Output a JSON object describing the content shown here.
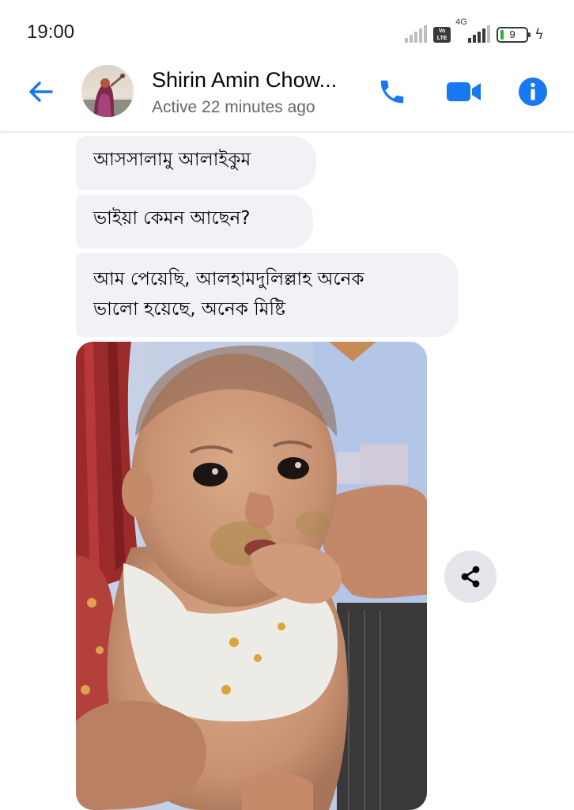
{
  "status_bar": {
    "time": "19:00",
    "volte_label": "Vo\nLTE",
    "network_label": "4G",
    "battery_level": "9"
  },
  "header": {
    "back_icon": "arrow-left-icon",
    "contact_name": "Shirin Amin Chow...",
    "contact_status": "Active 22 minutes ago",
    "accent_color": "#1877f2"
  },
  "messages": [
    {
      "text": "আসসালামু আলাইকুম"
    },
    {
      "text": "ভাইয়া কেমন আছেন?"
    },
    {
      "line1": "আম পেয়েছি, আলহামদুলিল্লাহ অনেক",
      "line2": "ভালো হয়েছে, অনেক মিষ্টি"
    }
  ],
  "photo": {
    "kind": "photo-of-baby"
  },
  "share_icon": "share-icon"
}
